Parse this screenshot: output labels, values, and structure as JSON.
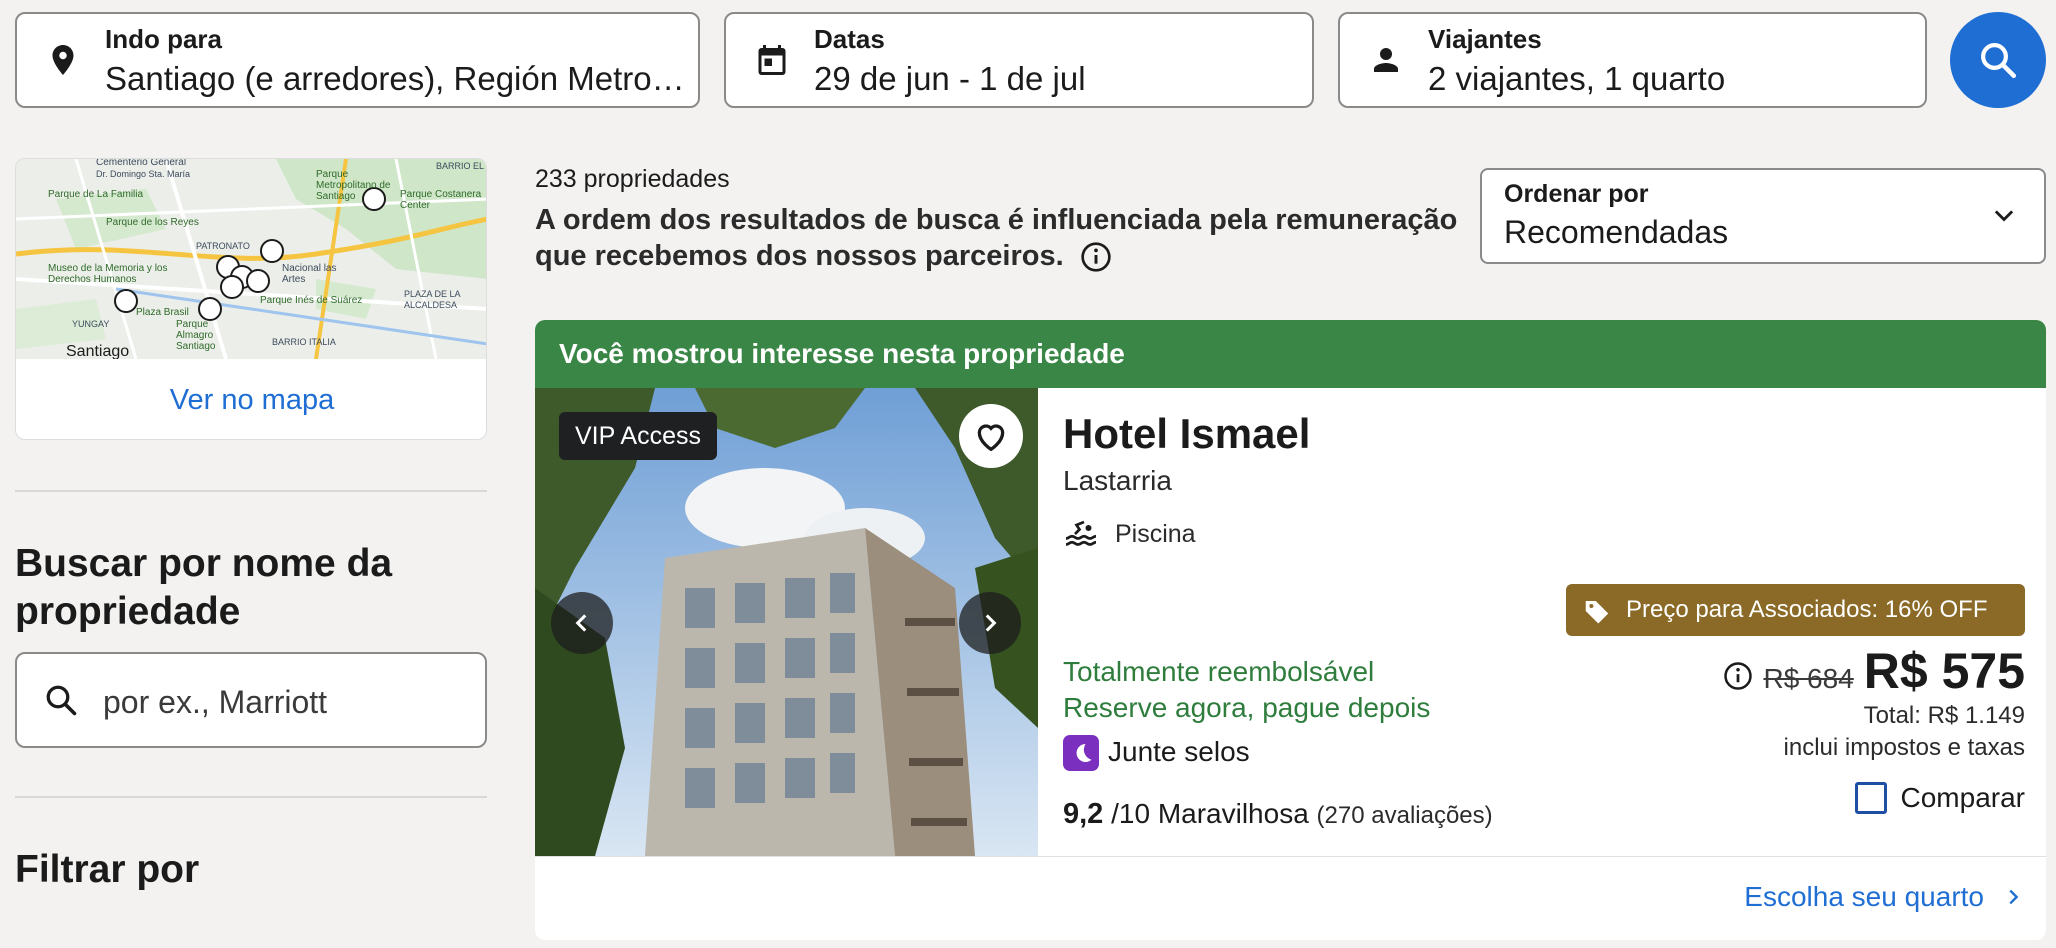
{
  "search": {
    "destination": {
      "label": "Indo para",
      "value": "Santiago (e arredores), Región Metro…",
      "icon": "location-pin-icon"
    },
    "dates": {
      "label": "Datas",
      "value": "29 de jun - 1 de jul",
      "icon": "calendar-icon"
    },
    "travelers": {
      "label": "Viajantes",
      "value": "2 viajantes, 1 quarto",
      "icon": "person-icon"
    },
    "submit_icon": "search-icon",
    "accent": "#1f6ed4"
  },
  "sidebar": {
    "map_link": "Ver no mapa",
    "map_labels": [
      "Cementerio General",
      "Dr. Domingo Sta. María",
      "Parque de La Familia",
      "Parque de los Reyes",
      "PATRONATO",
      "Parque Metropolitano de Santiago",
      "BARRIO EL",
      "Parque Costanera Center",
      "Museo de la Memoria y los Derechos Humanos",
      "Nacional las Artes",
      "Parque Inés de Suárez",
      "PLAZA DE LA ALCALDESA",
      "YUNGAY",
      "Plaza Brasil",
      "Parque Almagro Santiago",
      "BARRIO ITALIA",
      "Santiago"
    ],
    "name_search_title": "Buscar por nome da propriedade",
    "name_search_placeholder": "por ex., Marriott",
    "filter_title": "Filtrar por"
  },
  "results": {
    "count": "233 propriedades",
    "disclaimer": "A ordem dos resultados de busca é influenciada pela remuneração que recebemos dos nossos parceiros.",
    "sort": {
      "label": "Ordenar por",
      "value": "Recomendadas"
    }
  },
  "hotel": {
    "banner": "Você mostrou interesse nesta propriedade",
    "banner_color": "#3a8646",
    "vip_badge": "VIP Access",
    "name": "Hotel Ismael",
    "area": "Lastarria",
    "amenity": "Piscina",
    "refund": "Totalmente reembolsável",
    "pay_later": "Reserve agora, pague depois",
    "stamps": "Junte selos",
    "rating_score": "9,2",
    "rating_scale": "/10 Maravilhosa",
    "reviews": "(270 avaliações)",
    "promo": "Preço para Associados: 16% OFF",
    "promo_color": "#8a6a26",
    "old_price": "R$ 684",
    "price": "R$ 575",
    "total": "Total: R$ 1.149",
    "taxes": "inclui impostos e taxas",
    "compare": "Comparar",
    "choose_room": "Escolha seu quarto"
  }
}
